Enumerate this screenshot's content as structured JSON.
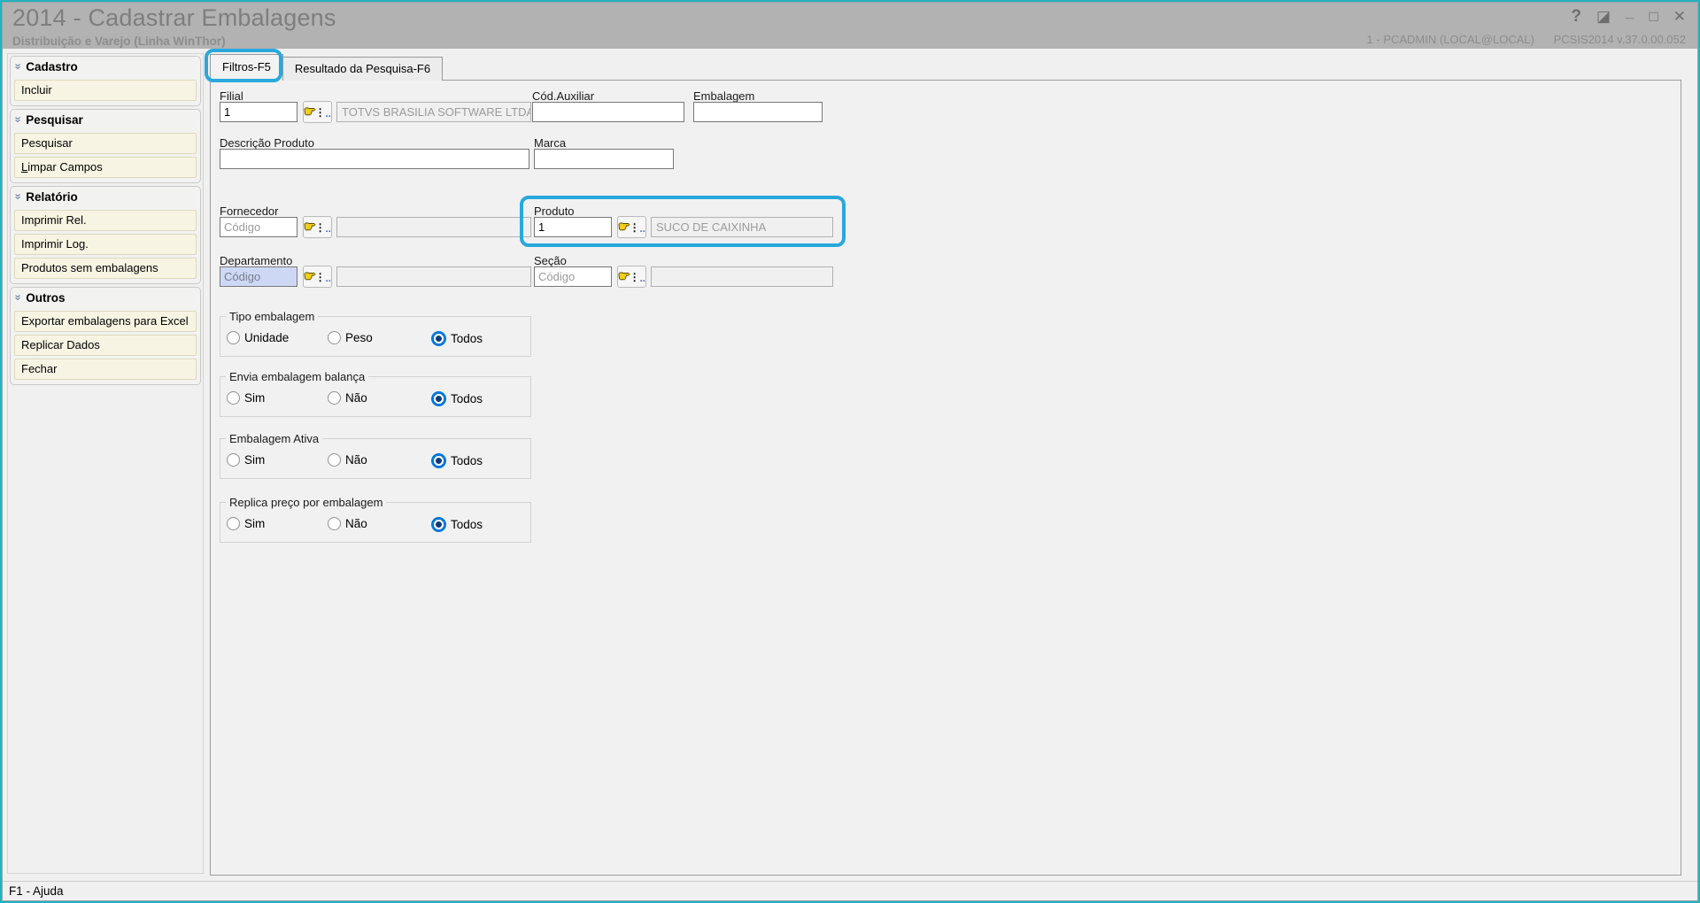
{
  "window": {
    "title": "2014 - Cadastrar Embalagens",
    "subtitle": "Distribuição e Varejo (Linha WinThor)",
    "session": "1 - PCADMIN (LOCAL@LOCAL)",
    "version": "PCSIS2014  v.37.0.00.052",
    "controls": {
      "help": "?",
      "restore": "◪",
      "minimize": "_",
      "maximize": "□",
      "close": "✕"
    }
  },
  "sidebar": {
    "sections": [
      {
        "title": "Cadastro",
        "items": [
          {
            "label": "Incluir"
          }
        ]
      },
      {
        "title": "Pesquisar",
        "items": [
          {
            "label": "Pesquisar"
          },
          {
            "label": "Limpar Campos"
          }
        ]
      },
      {
        "title": "Relatório",
        "items": [
          {
            "label": "Imprimir Rel."
          },
          {
            "label": "Imprimir Log."
          },
          {
            "label": "Produtos sem embalagens"
          }
        ]
      },
      {
        "title": "Outros",
        "items": [
          {
            "label": "Exportar embalagens para Excel"
          },
          {
            "label": "Replicar Dados"
          },
          {
            "label": "Fechar"
          }
        ]
      }
    ],
    "chevron": "»"
  },
  "tabs": {
    "filtros": "Filtros-F5",
    "resultado": "Resultado da Pesquisa-F6"
  },
  "form": {
    "filial": {
      "label": "Filial",
      "value": "1",
      "name": "TOTVS BRASILIA SOFTWARE LTDA"
    },
    "cod_auxiliar": {
      "label": "Cód.Auxiliar",
      "value": ""
    },
    "embalagem": {
      "label": "Embalagem",
      "value": ""
    },
    "descricao_produto": {
      "label": "Descrição Produto",
      "value": ""
    },
    "marca": {
      "label": "Marca",
      "value": ""
    },
    "fornecedor": {
      "label": "Fornecedor",
      "placeholder": "Código",
      "name": ""
    },
    "produto": {
      "label": "Produto",
      "value": "1",
      "name": "SUCO DE CAIXINHA"
    },
    "departamento": {
      "label": "Departamento",
      "placeholder": "Código",
      "name": ""
    },
    "secao": {
      "label": "Seção",
      "placeholder": "Código",
      "name": ""
    }
  },
  "lookup_icon": {
    "hand": "☛",
    "dots": "⋮",
    "ellipsis": ".."
  },
  "radio_groups": [
    {
      "title": "Tipo embalagem",
      "options": [
        "Unidade",
        "Peso",
        "Todos"
      ],
      "selected": "Todos"
    },
    {
      "title": "Envia embalagem balança",
      "options": [
        "Sim",
        "Não",
        "Todos"
      ],
      "selected": "Todos"
    },
    {
      "title": "Embalagem Ativa",
      "options": [
        "Sim",
        "Não",
        "Todos"
      ],
      "selected": "Todos"
    },
    {
      "title": "Replica preço por embalagem",
      "options": [
        "Sim",
        "Não",
        "Todos"
      ],
      "selected": "Todos"
    }
  ],
  "statusbar": {
    "help": "F1 - Ajuda"
  },
  "colors": {
    "annotation_highlight": "#29a8dc",
    "window_border": "#23b2bd",
    "titlebar_bg": "#b2b2b2",
    "radio_selected": "#0076dd",
    "focused_field_bg": "#cdd9f4",
    "sidebar_item_bg": "#f7f4e3"
  }
}
